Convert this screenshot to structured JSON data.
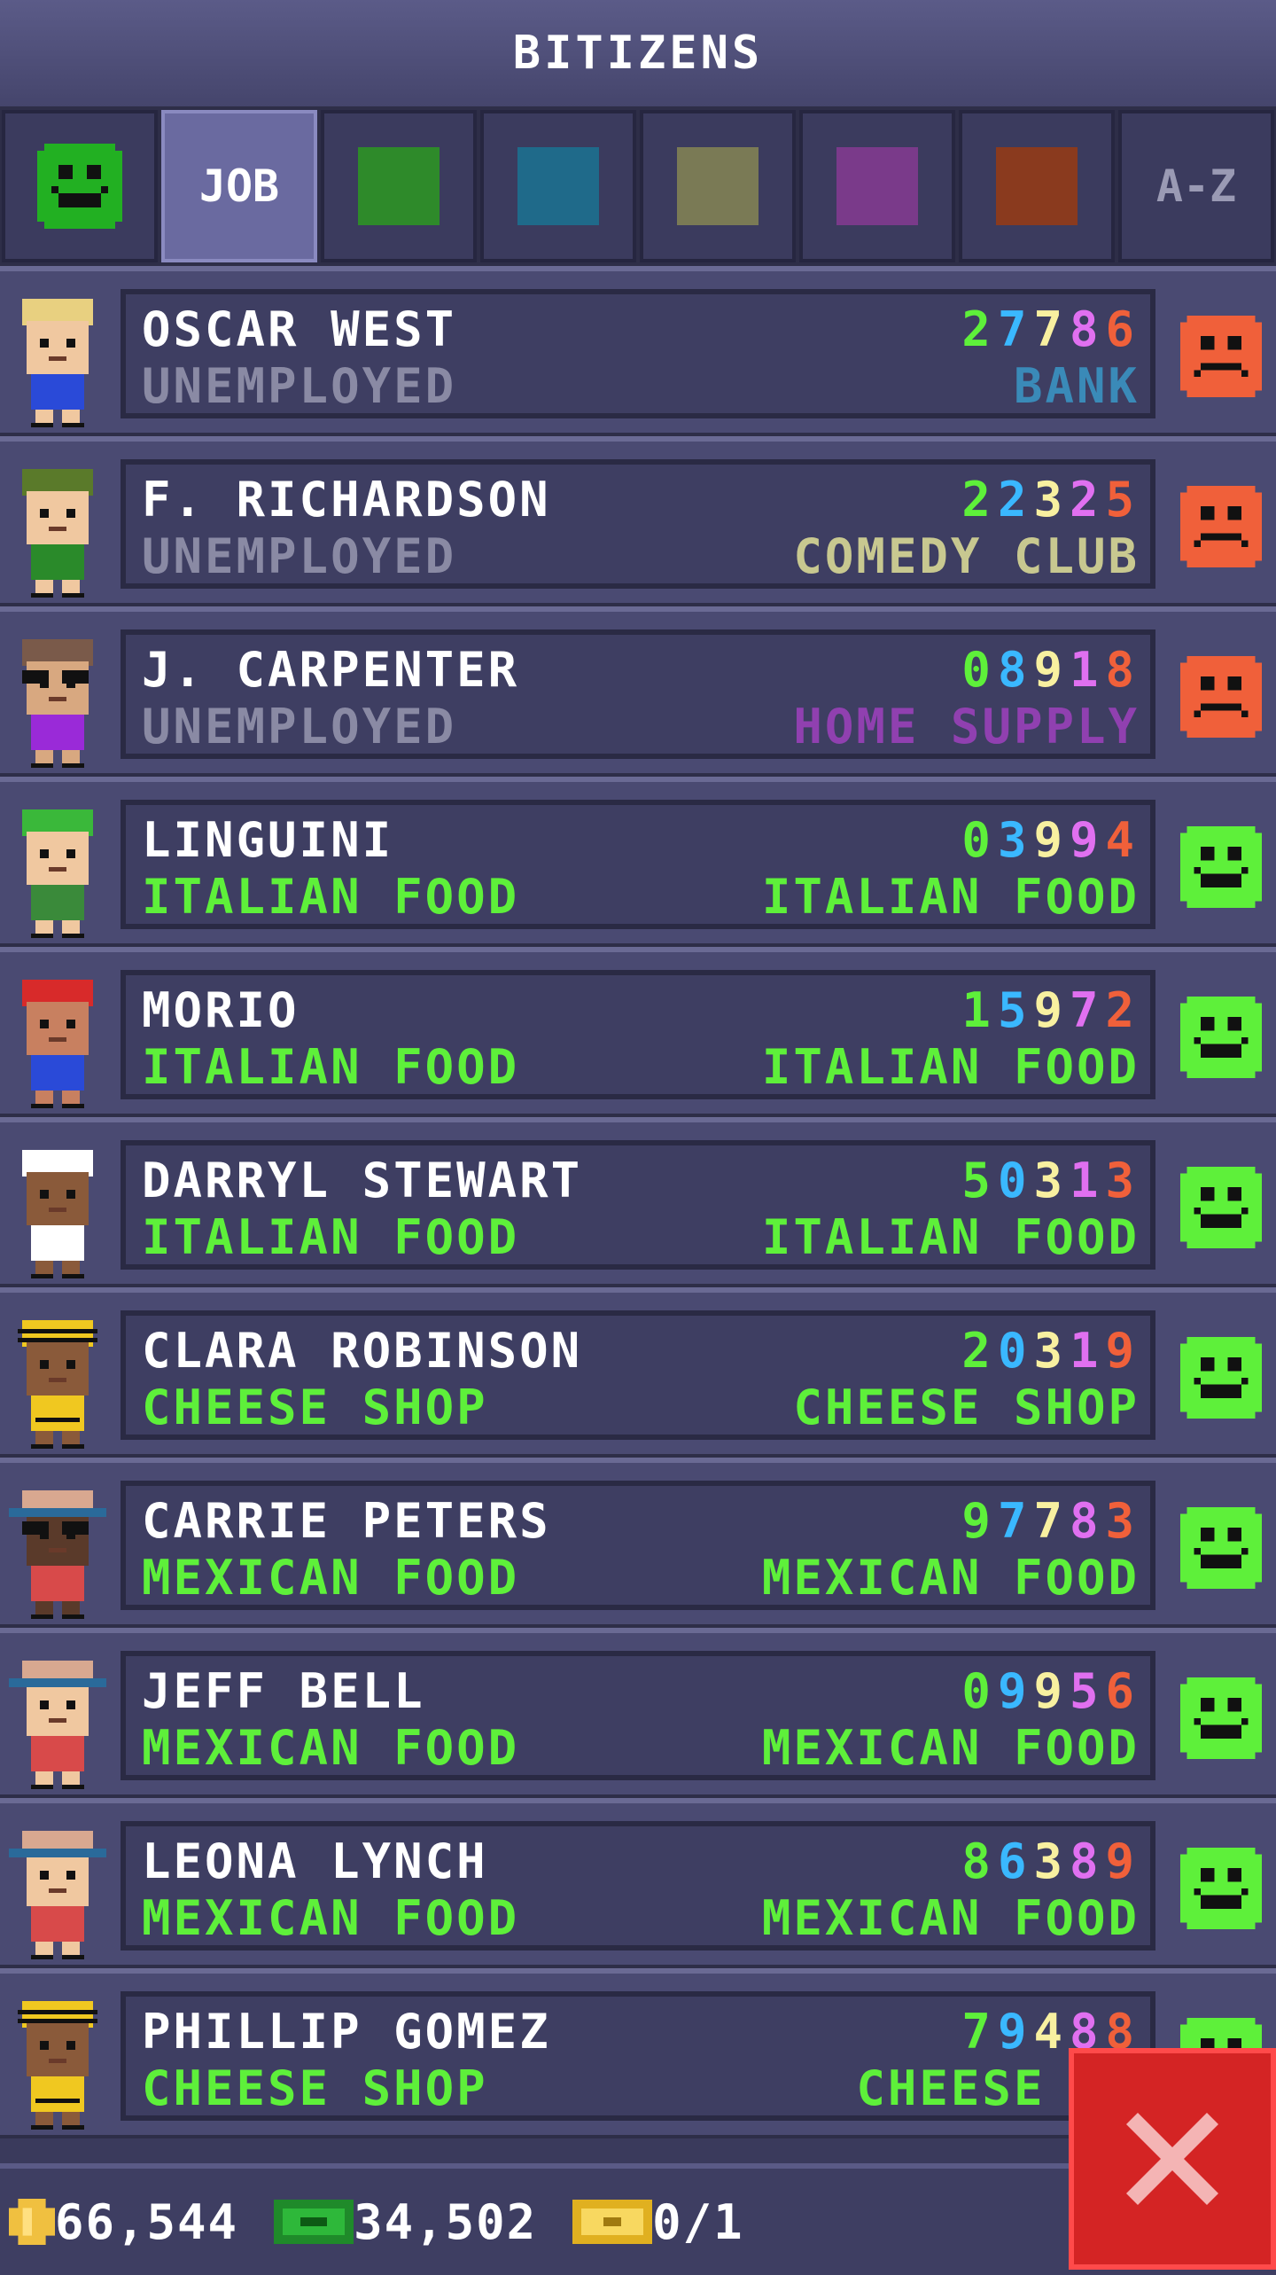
{
  "header": {
    "title": "BITIZENS"
  },
  "tabs": [
    {
      "type": "smiley",
      "color": "#22b022"
    },
    {
      "type": "label",
      "label": "JOB",
      "active": true
    },
    {
      "type": "color",
      "color": "#2e8a2a"
    },
    {
      "type": "color",
      "color": "#1f6a8a"
    },
    {
      "type": "color",
      "color": "#7a7a55"
    },
    {
      "type": "color",
      "color": "#7a3a8a"
    },
    {
      "type": "color",
      "color": "#8a3a1e"
    },
    {
      "type": "label",
      "label": "A-Z"
    }
  ],
  "colors": {
    "unemployed": "#8a8aa4",
    "employed": "#5ef03a",
    "happy": "#5ef03a",
    "sad": "#f0603a",
    "digits": [
      "#5ef03a",
      "#3ab8ff",
      "#f8f0a0",
      "#e070f0",
      "#f0603a"
    ]
  },
  "rows": [
    {
      "name": "OSCAR WEST",
      "job": "UNEMPLOYED",
      "digits": "27786",
      "workplace": "BANK",
      "workplace_color": "#3a8ab8",
      "mood": "sad",
      "avatar": "blond"
    },
    {
      "name": "F. RICHARDSON",
      "job": "UNEMPLOYED",
      "digits": "22325",
      "workplace": "COMEDY CLUB",
      "workplace_color": "#c8c890",
      "mood": "sad",
      "avatar": "hat-green"
    },
    {
      "name": "J. CARPENTER",
      "job": "UNEMPLOYED",
      "digits": "08918",
      "workplace": "HOME SUPPLY",
      "workplace_color": "#9040b0",
      "mood": "sad",
      "avatar": "glasses"
    },
    {
      "name": "LINGUINI",
      "job": "ITALIAN FOOD",
      "digits": "03994",
      "workplace": "ITALIAN FOOD",
      "workplace_color": "#5ef03a",
      "mood": "happy",
      "avatar": "green-cap"
    },
    {
      "name": "MORIO",
      "job": "ITALIAN FOOD",
      "digits": "15972",
      "workplace": "ITALIAN FOOD",
      "workplace_color": "#5ef03a",
      "mood": "happy",
      "avatar": "red-cap"
    },
    {
      "name": "DARRYL STEWART",
      "job": "ITALIAN FOOD",
      "digits": "50313",
      "workplace": "ITALIAN FOOD",
      "workplace_color": "#5ef03a",
      "mood": "happy",
      "avatar": "chef"
    },
    {
      "name": "CLARA ROBINSON",
      "job": "CHEESE SHOP",
      "digits": "20319",
      "workplace": "CHEESE SHOP",
      "workplace_color": "#5ef03a",
      "mood": "happy",
      "avatar": "bee"
    },
    {
      "name": "CARRIE PETERS",
      "job": "MEXICAN FOOD",
      "digits": "97783",
      "workplace": "MEXICAN FOOD",
      "workplace_color": "#5ef03a",
      "mood": "happy",
      "avatar": "sombrero-dark"
    },
    {
      "name": "JEFF BELL",
      "job": "MEXICAN FOOD",
      "digits": "09956",
      "workplace": "MEXICAN FOOD",
      "workplace_color": "#5ef03a",
      "mood": "happy",
      "avatar": "sombrero"
    },
    {
      "name": "LEONA LYNCH",
      "job": "MEXICAN FOOD",
      "digits": "86389",
      "workplace": "MEXICAN FOOD",
      "workplace_color": "#5ef03a",
      "mood": "happy",
      "avatar": "sombrero-light"
    },
    {
      "name": "PHILLIP GOMEZ",
      "job": "CHEESE SHOP",
      "digits": "79488",
      "workplace": "CHEESE SH",
      "workplace_color": "#5ef03a",
      "mood": "happy",
      "avatar": "bee-beard"
    }
  ],
  "footer": {
    "coins": "66,544",
    "bux": "34,502",
    "tickets": "0/1",
    "coin_icon": "coin-icon",
    "bux_icon": "bux-icon",
    "ticket_icon": "ticket-icon"
  },
  "close_icon": "close-icon"
}
